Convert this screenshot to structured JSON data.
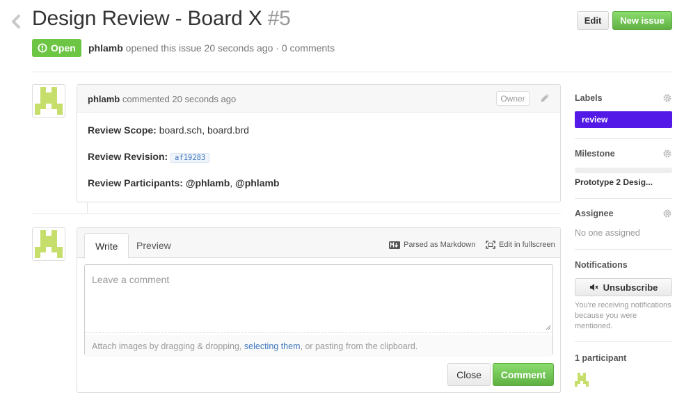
{
  "issue": {
    "title": "Design Review - Board X",
    "number": "#5",
    "state": "Open",
    "author": "phlamb",
    "meta_text": "opened this issue 20 seconds ago · 0 comments"
  },
  "header_buttons": {
    "edit_label": "Edit",
    "new_issue_label": "New issue"
  },
  "comment": {
    "author": "phlamb",
    "action": "commented 20 seconds ago",
    "role_badge": "Owner",
    "scope_label": "Review Scope:",
    "scope_value": "board.sch, board.brd",
    "revision_label": "Review Revision:",
    "revision_value": "af19283",
    "participants_label": "Review Participants:",
    "participant_1": "@phlamb",
    "participant_sep": ",",
    "participant_2": "@phlamb"
  },
  "new_comment": {
    "tab_write": "Write",
    "tab_preview": "Preview",
    "markdown_hint": "Parsed as Markdown",
    "fullscreen_hint": "Edit in fullscreen",
    "placeholder": "Leave a comment",
    "attach_prefix": "Attach images by dragging & dropping, ",
    "attach_link": "selecting them",
    "attach_suffix": ", or pasting from the clipboard.",
    "close_label": "Close",
    "comment_label": "Comment"
  },
  "sidebar": {
    "labels_title": "Labels",
    "label_review": "review",
    "label_color": "#5319e7",
    "milestone_title": "Milestone",
    "milestone_name": "Prototype 2 Desig...",
    "milestone_progress": 0,
    "assignee_title": "Assignee",
    "assignee_value": "No one assigned",
    "notifications_title": "Notifications",
    "unsubscribe_label": "Unsubscribe",
    "notification_reason": "You're receiving notifications because you were mentioned.",
    "participants_count": "1 participant"
  },
  "colors": {
    "open_green": "#6cc644",
    "link_blue": "#4078c0",
    "avatar_green": "#c6de6b"
  }
}
